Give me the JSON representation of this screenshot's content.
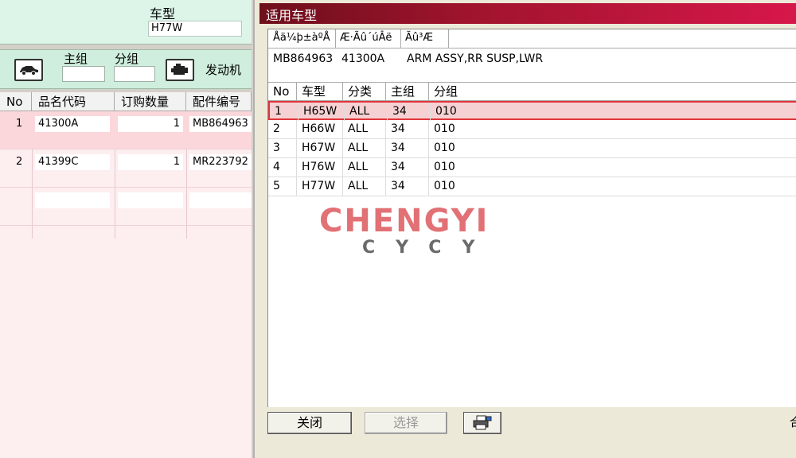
{
  "background_app": {
    "model_label": "车型",
    "model_value": "H77W",
    "main_group_label": "主组",
    "sub_group_label": "分组",
    "engine_label": "发动机",
    "car_icon": "car-icon",
    "engine_icon": "engine-icon",
    "grid": {
      "headers": [
        "No",
        "品名代码",
        "订购数量",
        "配件编号"
      ],
      "rows": [
        {
          "no": "1",
          "code": "41300A",
          "qty": "1",
          "part": "MB864963"
        },
        {
          "no": "2",
          "code": "41399C",
          "qty": "1",
          "part": "MR223792"
        }
      ]
    }
  },
  "dialog": {
    "title": "适用车型",
    "info": {
      "headers": [
        "Åä¼þ±àºÅ",
        "Æ·Ãû´úÂë",
        "Ãû³Æ"
      ],
      "values": [
        "MB864963",
        "41300A",
        "ARM ASSY,RR SUSP,LWR"
      ]
    },
    "models": {
      "headers": [
        "No",
        "车型",
        "分类",
        "主组",
        "分组"
      ],
      "rows": [
        {
          "no": "1",
          "model": "H65W",
          "class": "ALL",
          "main": "34",
          "sub": "010"
        },
        {
          "no": "2",
          "model": "H66W",
          "class": "ALL",
          "main": "34",
          "sub": "010"
        },
        {
          "no": "3",
          "model": "H67W",
          "class": "ALL",
          "main": "34",
          "sub": "010"
        },
        {
          "no": "4",
          "model": "H76W",
          "class": "ALL",
          "main": "34",
          "sub": "010"
        },
        {
          "no": "5",
          "model": "H77W",
          "class": "ALL",
          "main": "34",
          "sub": "010"
        }
      ],
      "selected_index": 0
    },
    "watermark": {
      "main": "CHENGYI",
      "sub": "CYCY"
    },
    "buttons": {
      "close": "关闭",
      "select": "选择",
      "print_icon": "printer-icon"
    },
    "corner_text": "合"
  },
  "colors": {
    "title_gradient_start": "#6e0f1b",
    "title_gradient_end": "#d7174a",
    "selection_border": "#e0353a",
    "selection_fill": "#f6d1d3"
  }
}
